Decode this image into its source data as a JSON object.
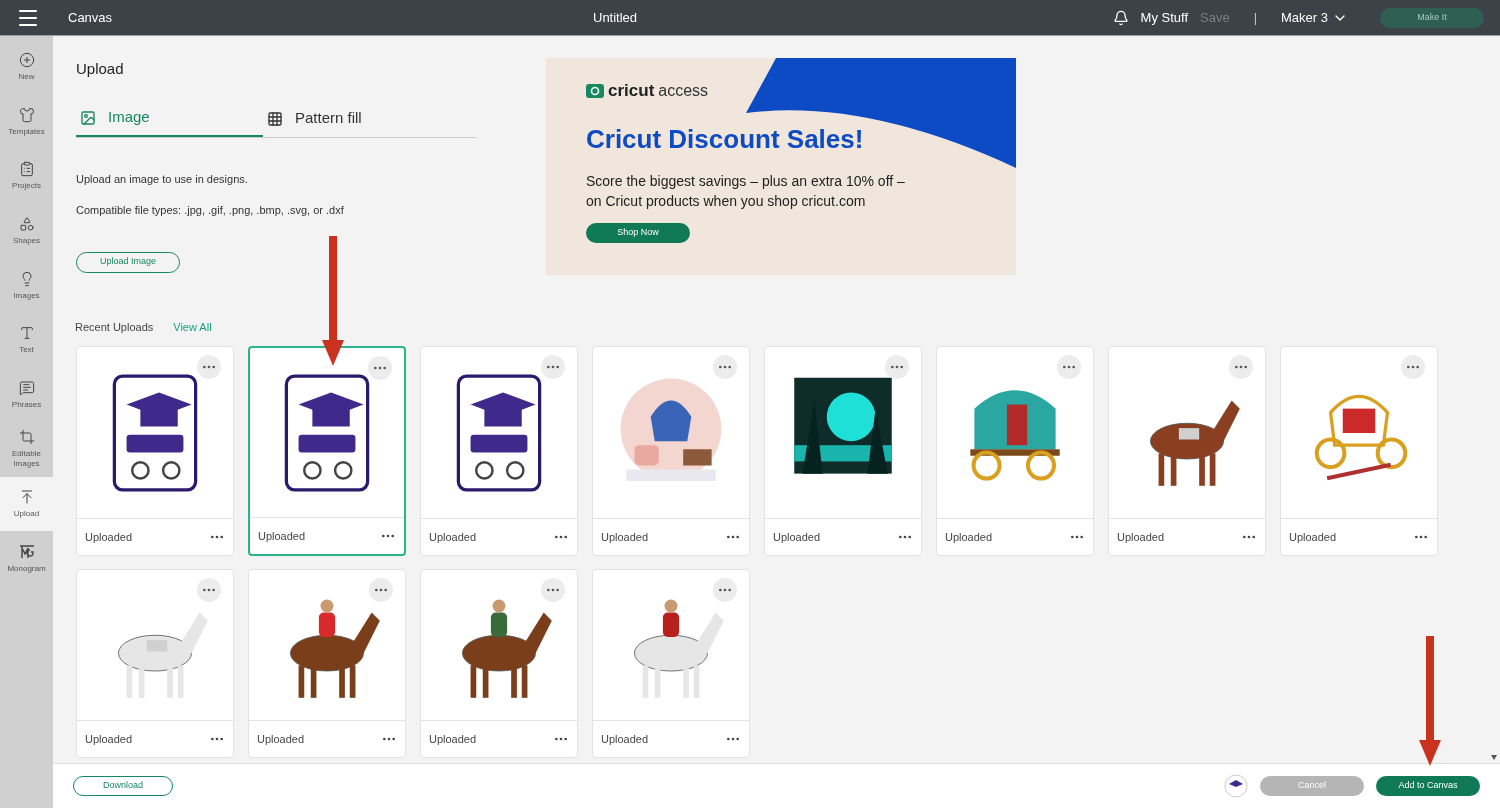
{
  "header": {
    "title": "Canvas",
    "document": "Untitled",
    "my_stuff": "My Stuff",
    "save": {
      "label": "Save",
      "disabled": true
    },
    "separator": "|",
    "machine": "Maker 3",
    "make_it": {
      "label": "Make It",
      "disabled": true
    }
  },
  "sidebar": {
    "items": [
      {
        "label": "New",
        "selected": false
      },
      {
        "label": "Templates",
        "selected": false
      },
      {
        "label": "Projects",
        "selected": false
      },
      {
        "label": "Shapes",
        "selected": false
      },
      {
        "label": "Images",
        "selected": false
      },
      {
        "label": "Text",
        "selected": false
      },
      {
        "label": "Phrases",
        "selected": false
      },
      {
        "label": "Editable Images",
        "selected": false
      },
      {
        "label": "Upload",
        "selected": true
      },
      {
        "label": "Monogram",
        "selected": false
      }
    ]
  },
  "panel": {
    "title": "Upload",
    "tabs": [
      {
        "label": "Image",
        "selected": true
      },
      {
        "label": "Pattern fill",
        "selected": false
      }
    ],
    "description": "Upload an image to use in designs.",
    "file_types": "Compatible file types: .jpg, .gif, .png, .bmp, .svg, or .dxf",
    "upload_button": "Upload Image"
  },
  "banner": {
    "brand": "cricut",
    "brand_suffix": "access",
    "headline": "Cricut Discount Sales!",
    "body_1": "Score the biggest savings – plus an extra 10% off –",
    "body_2": "on Cricut products when you shop cricut.com",
    "button": "Shop Now"
  },
  "recent_uploads": {
    "title": "Recent Uploads",
    "view_all": "View All",
    "items": [
      {
        "caption": "Uploaded",
        "selected": false
      },
      {
        "caption": "Uploaded",
        "selected": true
      },
      {
        "caption": "Uploaded",
        "selected": false
      },
      {
        "caption": "Uploaded",
        "selected": false
      },
      {
        "caption": "Uploaded",
        "selected": false
      },
      {
        "caption": "Uploaded",
        "selected": false
      },
      {
        "caption": "Uploaded",
        "selected": false
      },
      {
        "caption": "Uploaded",
        "selected": false
      },
      {
        "caption": "Uploaded",
        "selected": false
      },
      {
        "caption": "Uploaded",
        "selected": false
      },
      {
        "caption": "Uploaded",
        "selected": false
      },
      {
        "caption": "Uploaded",
        "selected": false
      }
    ]
  },
  "footer": {
    "download": "Download",
    "cancel": "Cancel",
    "add": "Add to Canvas"
  }
}
